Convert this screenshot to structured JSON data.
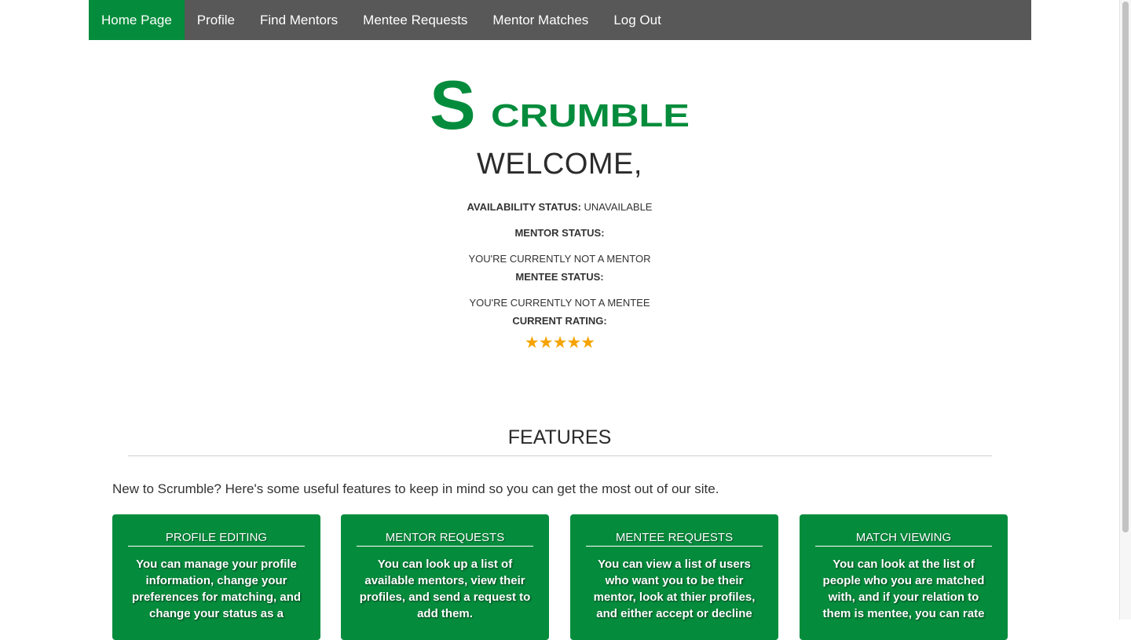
{
  "nav": {
    "items": [
      {
        "label": "Home Page",
        "active": true
      },
      {
        "label": "Profile",
        "active": false
      },
      {
        "label": "Find Mentors",
        "active": false
      },
      {
        "label": "Mentee Requests",
        "active": false
      },
      {
        "label": "Mentor Matches",
        "active": false
      },
      {
        "label": "Log Out",
        "active": false
      }
    ]
  },
  "logo": {
    "big_letter": "S",
    "rest": "CRUMBLE"
  },
  "welcome": "WELCOME,",
  "status": {
    "availability_label": "AVAILABILITY STATUS:",
    "availability_value": "UNAVAILABLE",
    "mentor_label": "MENTOR STATUS:",
    "mentor_value": "YOU'RE CURRENTLY NOT A MENTOR",
    "mentee_label": "MENTEE STATUS:",
    "mentee_value": "YOU'RE CURRENTLY NOT A MENTEE",
    "rating_label": "CURRENT RATING:",
    "rating_stars": "★★★★★",
    "rating_value": 5
  },
  "features": {
    "title": "FEATURES",
    "intro": "New to Scrumble? Here's some useful features to keep in mind so you can get the most out of our site.",
    "cards": [
      {
        "title": "PROFILE EDITING",
        "body": "You can manage your profile information, change your preferences for matching, and change your status as a"
      },
      {
        "title": "MENTOR REQUESTS",
        "body": "You can look up a list of available mentors, view their profiles, and send a request to add them."
      },
      {
        "title": "MENTEE REQUESTS",
        "body": "You can view a list of users who want you to be their mentor, look at thier profiles, and either accept or decline"
      },
      {
        "title": "MATCH VIEWING",
        "body": "You can look at the list of people who you are matched with, and if your relation to them is mentee, you can rate"
      }
    ]
  },
  "colors": {
    "brand_green": "#048c3c",
    "nav_bg": "#585858",
    "star": "#f5a300"
  }
}
